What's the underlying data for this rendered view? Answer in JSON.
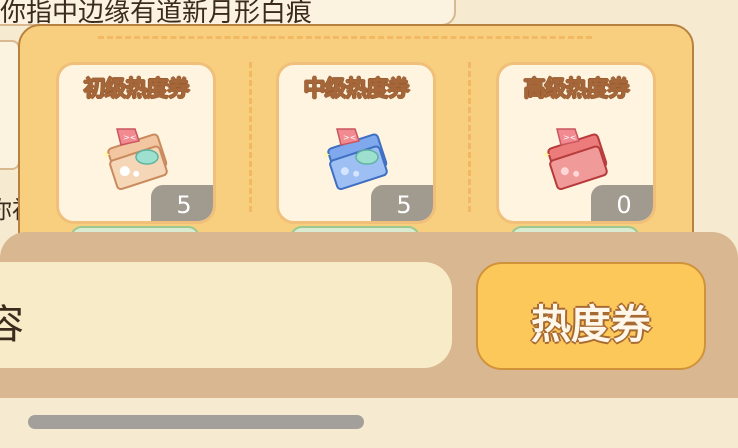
{
  "chat": {
    "top_message": "你指中边缘有道新月形白痕",
    "left_fragment": "你衫"
  },
  "panel": {
    "cards": [
      {
        "title": "初级热度券",
        "count": "5",
        "icon": "ticket-basic-icon",
        "color": "#e8a36a"
      },
      {
        "title": "中级热度券",
        "count": "5",
        "icon": "ticket-medium-icon",
        "color": "#5d8fe0"
      },
      {
        "title": "高级热度券",
        "count": "0",
        "icon": "ticket-advanced-icon",
        "color": "#e05a5a"
      }
    ]
  },
  "input": {
    "text": "容"
  },
  "toolbar": {
    "ticket_button_label": "热度券"
  }
}
